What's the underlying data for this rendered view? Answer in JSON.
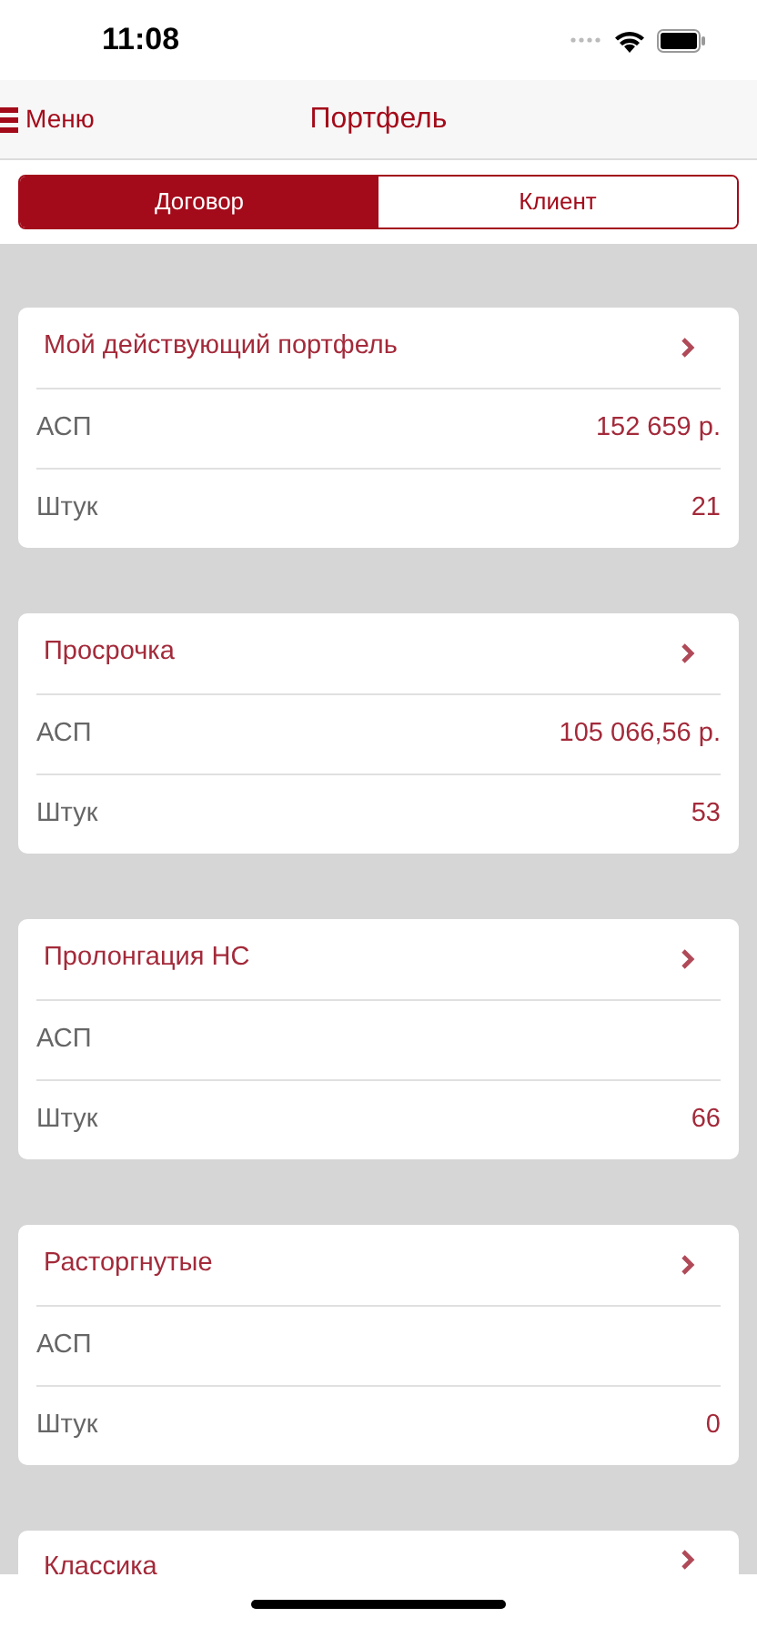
{
  "status_bar": {
    "time": "11:08"
  },
  "nav": {
    "back": "Меню",
    "title": "Портфель"
  },
  "segments": [
    {
      "label": "Договор",
      "selected": true
    },
    {
      "label": "Клиент",
      "selected": false
    }
  ],
  "cards": [
    {
      "title": "Мой действующий портфель",
      "rows": [
        {
          "label": "АСП",
          "value": "152 659 р."
        },
        {
          "label": "Штук",
          "value": "21"
        }
      ]
    },
    {
      "title": "Просрочка",
      "rows": [
        {
          "label": "АСП",
          "value": "105 066,56 р."
        },
        {
          "label": "Штук",
          "value": "53"
        }
      ]
    },
    {
      "title": "Пролонгация НС",
      "rows": [
        {
          "label": "АСП"
        },
        {
          "label": "Штук",
          "value": "66"
        }
      ]
    },
    {
      "title": "Расторгнутые",
      "rows": [
        {
          "label": "АСП"
        },
        {
          "label": "Штук",
          "value": "0"
        }
      ]
    },
    {
      "title": "Классика"
    }
  ]
}
